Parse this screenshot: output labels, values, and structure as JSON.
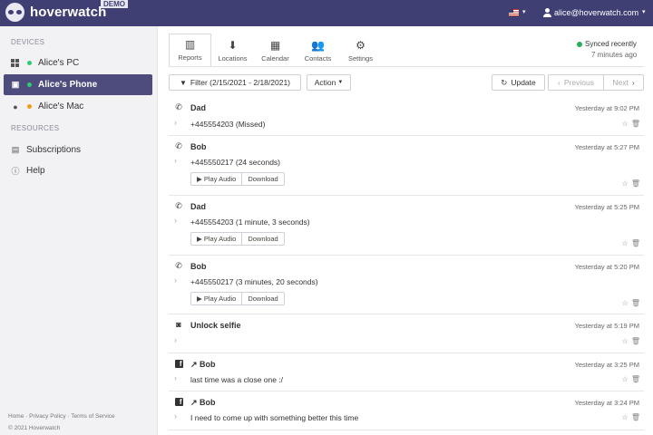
{
  "header": {
    "logo_text": "hoverwatch",
    "demo_badge": "DEMO",
    "user_email": "alice@hoverwatch.com"
  },
  "sidebar": {
    "devices_title": "DEVICES",
    "devices": [
      {
        "label": "Alice's PC",
        "icon": "windows-icon",
        "status_color": "#2ecc71"
      },
      {
        "label": "Alice's Phone",
        "icon": "android-icon",
        "status_color": "#2ecc71",
        "active": true
      },
      {
        "label": "Alice's Mac",
        "icon": "apple-icon",
        "status_color": "#f39c12"
      }
    ],
    "resources_title": "RESOURCES",
    "resources": [
      {
        "label": "Subscriptions",
        "icon": "card-icon"
      },
      {
        "label": "Help",
        "icon": "info-icon"
      }
    ],
    "footer_links": "Home · Privacy Policy · Terms of Service",
    "copyright": "© 2021 Hoverwatch"
  },
  "tabs": [
    {
      "label": "Reports",
      "icon": "bar-chart-icon",
      "active": true
    },
    {
      "label": "Locations",
      "icon": "location-icon"
    },
    {
      "label": "Calendar",
      "icon": "calendar-icon"
    },
    {
      "label": "Contacts",
      "icon": "contacts-icon"
    },
    {
      "label": "Settings",
      "icon": "settings-icon"
    }
  ],
  "sync": {
    "status": "Synced recently",
    "time": "7 minutes ago"
  },
  "toolbar": {
    "filter_label": "Filter (2/15/2021 - 2/18/2021)",
    "action_label": "Action",
    "update_label": "Update",
    "previous_label": "Previous",
    "next_label": "Next"
  },
  "audio": {
    "play_label": "Play Audio",
    "download_label": "Download"
  },
  "entries": [
    {
      "type": "call",
      "title": "Dad",
      "time": "Yesterday at 9:02 PM",
      "text": "+445554203 (Missed)"
    },
    {
      "type": "call",
      "title": "Bob",
      "time": "Yesterday at 5:27 PM",
      "text": "+445550217 (24 seconds)"
    },
    {
      "type": "call",
      "title": "Dad",
      "time": "Yesterday at 5:25 PM",
      "text": "+445554203 (1 minute, 3 seconds)"
    },
    {
      "type": "call",
      "title": "Bob",
      "time": "Yesterday at 5:20 PM",
      "text": "+445550217 (3 minutes, 20 seconds)"
    },
    {
      "type": "camera",
      "title": "Unlock selfie",
      "time": "Yesterday at 5:19 PM",
      "text": ""
    },
    {
      "type": "facebook",
      "title": "↗ Bob",
      "time": "Yesterday at 3:25 PM",
      "text": "last time was a close one :/"
    },
    {
      "type": "facebook",
      "title": "↗ Bob",
      "time": "Yesterday at 3:24 PM",
      "text": "I need to come up with something better this time"
    }
  ]
}
